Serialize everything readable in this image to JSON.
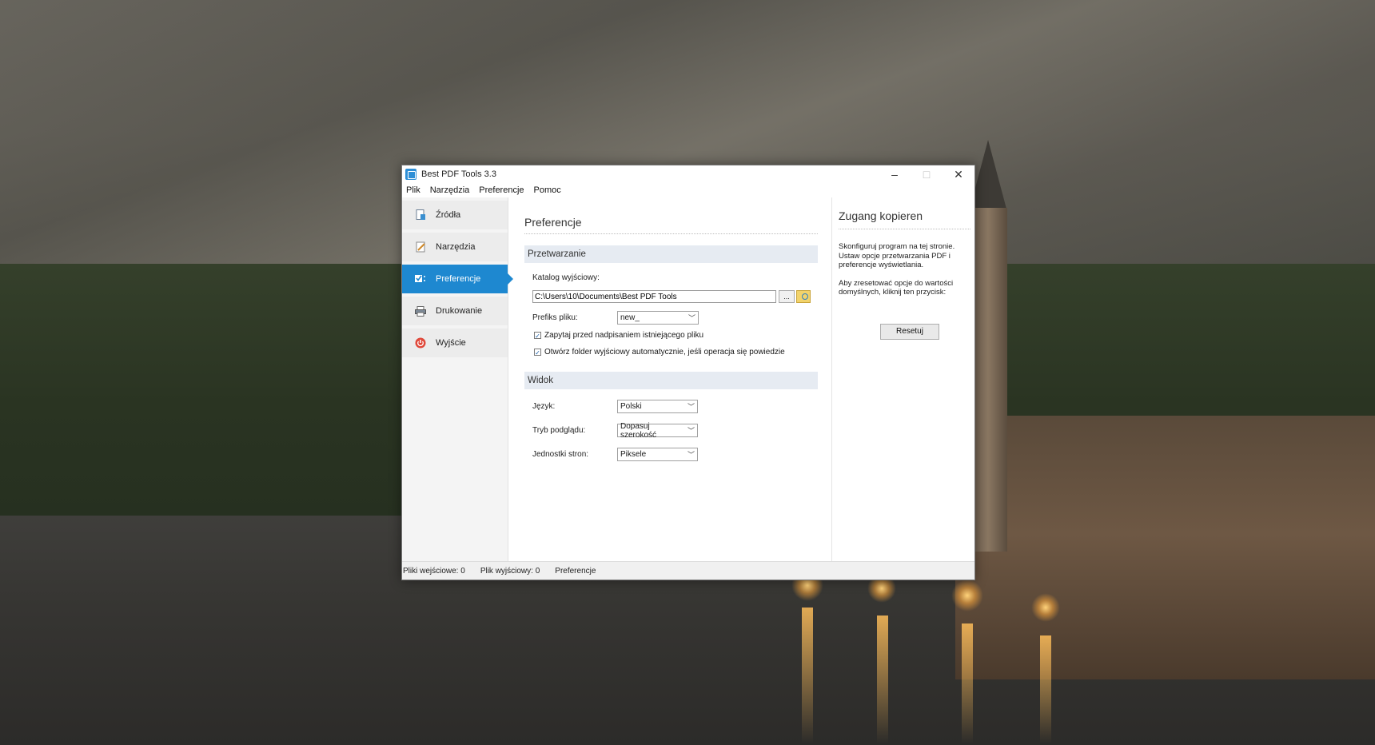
{
  "window": {
    "title": "Best PDF Tools 3.3",
    "controls": {
      "minimize": "–",
      "maximize": "□",
      "close": "✕"
    }
  },
  "menu": [
    "Plik",
    "Narzędzia",
    "Preferencje",
    "Pomoc"
  ],
  "sidebar": {
    "items": [
      {
        "label": "Źródła",
        "icon": "sources-icon"
      },
      {
        "label": "Narzędzia",
        "icon": "tools-icon"
      },
      {
        "label": "Preferencje",
        "icon": "preferences-icon",
        "active": true
      },
      {
        "label": "Drukowanie",
        "icon": "printer-icon"
      },
      {
        "label": "Wyjście",
        "icon": "exit-icon"
      }
    ]
  },
  "main": {
    "title": "Preferencje",
    "processing": {
      "header": "Przetwarzanie",
      "output_dir_label": "Katalog wyjściowy:",
      "output_dir_value": "C:\\Users\\10\\Documents\\Best PDF Tools",
      "browse_label": "...",
      "prefix_label": "Prefiks pliku:",
      "prefix_value": "new_",
      "ask_overwrite_label": "Zapytaj przed nadpisaniem istniejącego pliku",
      "ask_overwrite_checked": true,
      "open_folder_label": "Otwórz folder wyjściowy automatycznie, jeśli operacja się powiedzie",
      "open_folder_checked": true
    },
    "view": {
      "header": "Widok",
      "language_label": "Język:",
      "language_value": "Polski",
      "preview_label": "Tryb podglądu:",
      "preview_value": "Dopasuj szerokość",
      "units_label": "Jednostki stron:",
      "units_value": "Piksele"
    }
  },
  "right_panel": {
    "title": "Zugang kopieren",
    "text1": "Skonfiguruj program na tej stronie. Ustaw opcje przetwarzania PDF i preferencje wyświetlania.",
    "text2": "Aby zresetować opcje do wartości domyślnych, kliknij ten przycisk:",
    "reset_label": "Resetuj"
  },
  "status": {
    "input_files": "Pliki wejściowe: 0",
    "output_file": "Plik wyjściowy: 0",
    "page": "Preferencje"
  },
  "colors": {
    "accent": "#1e88d0",
    "section_bg": "#e6ebf2"
  }
}
